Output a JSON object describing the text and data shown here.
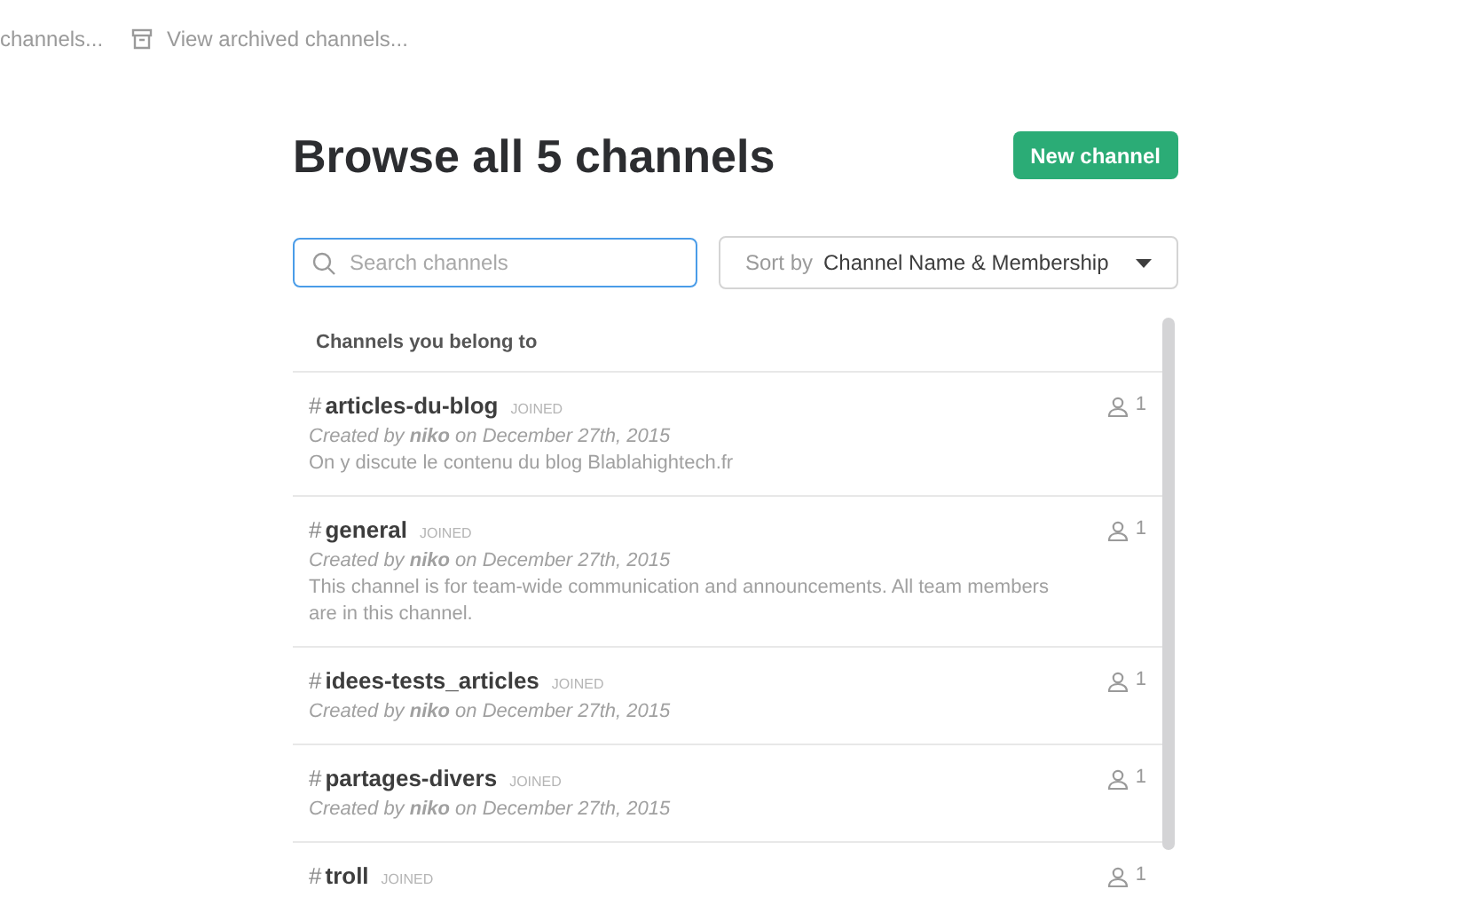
{
  "top_links": [
    {
      "label": "channels...",
      "icon": false
    },
    {
      "label": "View archived channels...",
      "icon": true
    }
  ],
  "title": "Browse all 5 channels",
  "new_button": "New channel",
  "search": {
    "placeholder": "Search channels"
  },
  "sort": {
    "label": "Sort by",
    "value": "Channel Name & Membership"
  },
  "section_header": "Channels you belong to",
  "channels": [
    {
      "hash": "#",
      "name": "articles-du-blog",
      "badge": "JOINED",
      "created": "Created by **niko** on December 27th, 2015",
      "description": "On y discute le contenu du blog Blablahightech.fr",
      "members": "1"
    },
    {
      "hash": "#",
      "name": "general",
      "badge": "JOINED",
      "created": "Created by **niko** on December 27th, 2015",
      "description": "This channel is for team-wide communication and announcements. All team members are in this channel.",
      "members": "1"
    },
    {
      "hash": "#",
      "name": "idees-tests_articles",
      "badge": "JOINED",
      "created": "Created by **niko** on December 27th, 2015",
      "members": "1"
    },
    {
      "hash": "#",
      "name": "partages-divers",
      "badge": "JOINED",
      "created": "Created by **niko** on December 27th, 2015",
      "members": "1"
    },
    {
      "hash": "#",
      "name": "troll",
      "badge": "JOINED",
      "members": "1"
    }
  ]
}
